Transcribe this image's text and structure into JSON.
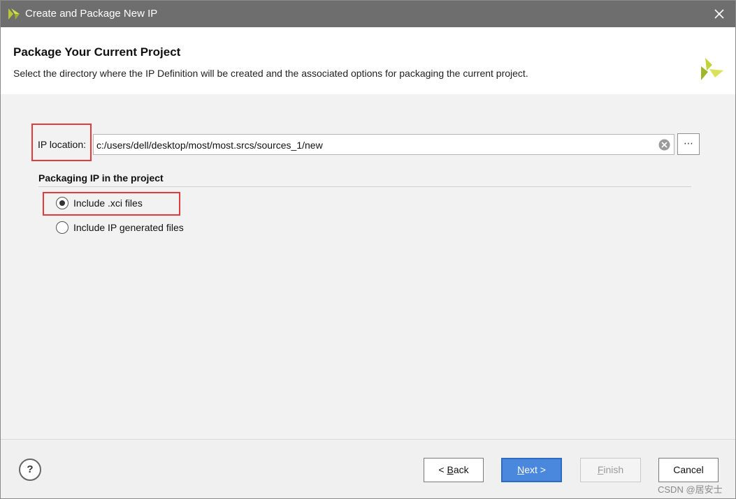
{
  "window": {
    "title": "Create and Package New IP",
    "app_icon": "vivado-logo-icon",
    "close_icon": "close-icon"
  },
  "header": {
    "title": "Package Your Current Project",
    "subtitle": "Select the directory where the IP Definition will be created and the associated options for packaging the current project.",
    "logo_icon": "xilinx-logo-icon"
  },
  "ip_location": {
    "label": "IP location:",
    "value": "c:/users/dell/desktop/most/most.srcs/sources_1/new",
    "clear_icon": "clear-icon",
    "browse_label": "⋯"
  },
  "packaging": {
    "section_title": "Packaging IP in the project",
    "options": [
      {
        "label": "Include .xci files",
        "selected": true
      },
      {
        "label": "Include IP generated files",
        "selected": false
      }
    ]
  },
  "footer": {
    "help_label": "?",
    "back_prefix": "< ",
    "back_key": "B",
    "back_rest": "ack",
    "next_key": "N",
    "next_rest": "ext >",
    "finish_key": "F",
    "finish_rest": "inish",
    "cancel_label": "Cancel"
  },
  "watermark": "CSDN @居安士",
  "colors": {
    "titlebar": "#6e6e6e",
    "highlight": "#e23b3b",
    "primary_button": "#4a88dd",
    "logo_green": "#8fae1b"
  }
}
